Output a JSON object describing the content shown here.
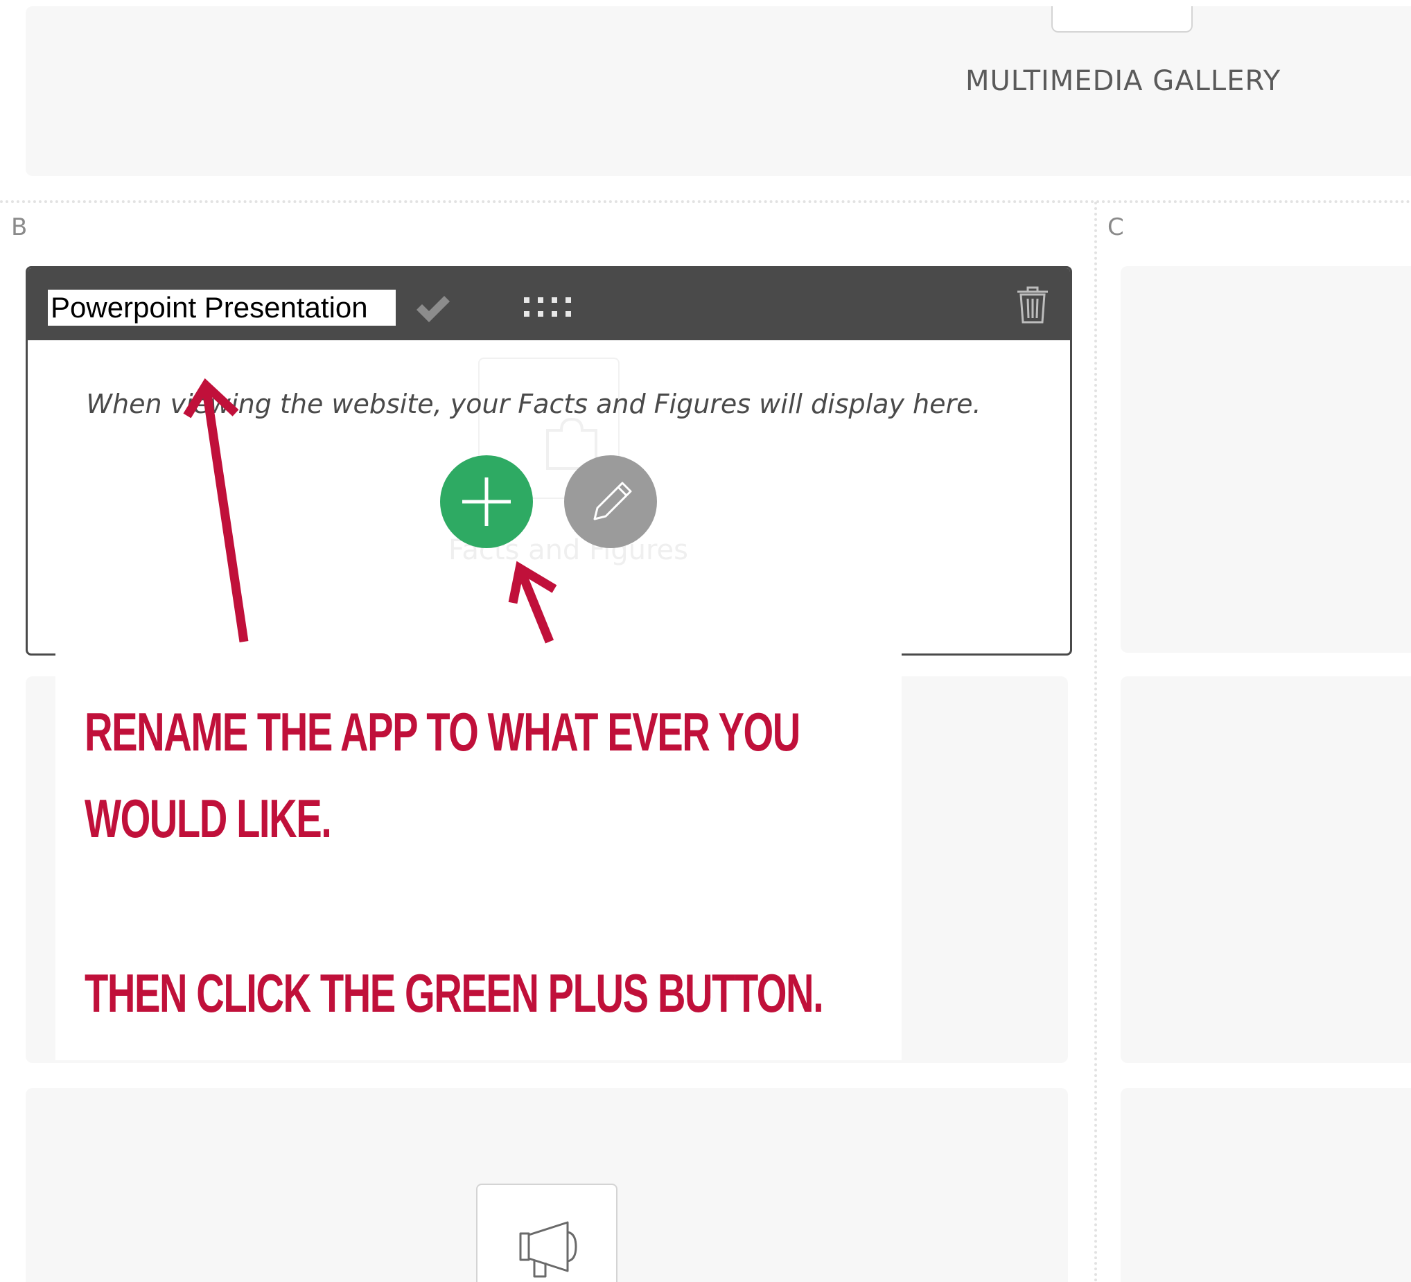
{
  "top_panel": {
    "label": "MULTIMEDIA GALLERY"
  },
  "columns": {
    "b_label": "B",
    "c_label": "C"
  },
  "app_widget": {
    "title_value": "Powerpoint Presentation",
    "info_text": "When viewing the website, your Facts and Figures will display here.",
    "placeholder_label": "Facts and Figures"
  },
  "annotation": {
    "line1": "Rename the app to what ever you",
    "line2": "would like.",
    "line3": "Then click the green plus button.",
    "color": "#c0103a"
  },
  "colors": {
    "header": "#4a4a4a",
    "add_button": "#2eaa63",
    "edit_button": "#9b9b9b",
    "slot_background": "#f7f7f7"
  },
  "icons": {
    "confirm": "check-icon",
    "drag": "drag-handle-icon",
    "delete": "trash-icon",
    "add": "plus-icon",
    "edit": "pencil-icon",
    "placeholder": "puzzle-piece-icon",
    "bottom_app": "megaphone-icon"
  }
}
